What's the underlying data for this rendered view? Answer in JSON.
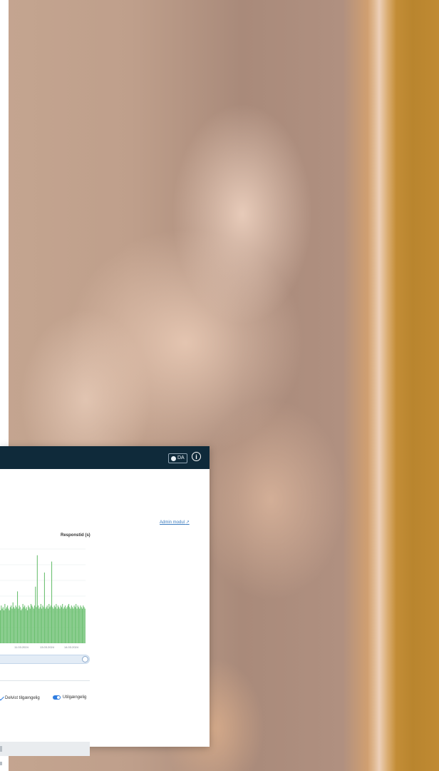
{
  "header": {
    "language_label": "DA",
    "info_icon": "info-icon"
  },
  "admin_link": {
    "label": "Admin modul",
    "icon": "external-link-icon"
  },
  "chart_data": {
    "type": "bar",
    "title": "Responstid (s)",
    "xlabel": "",
    "ylabel": "",
    "x_tick_labels": [
      "11.03.2024",
      "13.03.2024",
      "14.03.2024"
    ],
    "color": "#6cc071",
    "values": [
      2.1,
      2.4,
      2.2,
      2.3,
      2.1,
      2.5,
      2.2,
      2.3,
      2.4,
      2.2,
      2.1,
      2.3,
      2.4,
      2.2,
      2.6,
      2.3,
      2.2,
      2.4,
      2.3,
      3.3,
      2.2,
      2.4,
      2.3,
      2.1,
      2.2,
      2.5,
      2.3,
      2.4,
      2.2,
      2.3,
      2.1,
      2.4,
      2.3,
      2.2,
      2.5,
      2.4,
      2.3,
      2.2,
      2.4,
      3.6,
      2.3,
      5.6,
      2.4,
      2.2,
      2.3,
      2.5,
      2.2,
      2.4,
      2.3,
      4.5,
      2.2,
      2.3,
      2.4,
      2.2,
      2.5,
      2.3,
      2.4,
      5.2,
      2.3,
      2.2,
      2.4,
      2.3,
      2.5,
      2.2,
      2.4,
      2.3,
      2.2,
      2.4,
      2.3,
      2.5,
      2.2,
      2.3,
      2.4,
      2.2,
      2.3,
      2.4,
      2.5,
      2.3,
      2.2,
      2.4,
      2.3,
      2.2,
      2.4,
      2.3,
      2.5,
      2.2,
      2.4,
      2.3,
      2.2,
      2.4,
      2.3,
      2.2,
      2.4,
      2.3,
      2.2
    ],
    "ylim": [
      0,
      6
    ],
    "grid": true
  },
  "legend": {
    "partial": {
      "label": "Delvist tilgængelig",
      "icon": "check-icon"
    },
    "unavailable": {
      "label": "Utilgængelig",
      "icon": "toggle-icon"
    }
  }
}
